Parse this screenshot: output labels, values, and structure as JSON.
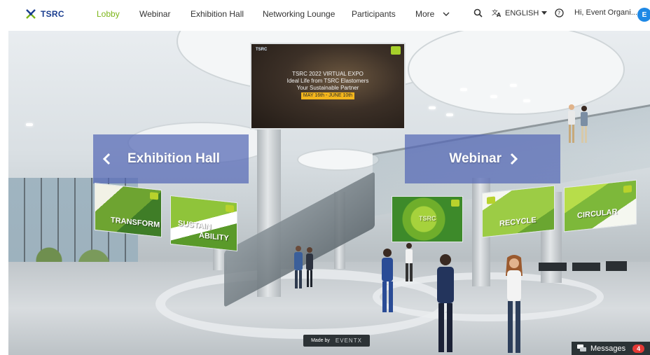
{
  "brand": {
    "name": "TSRC"
  },
  "nav": {
    "items": [
      {
        "label": "Lobby",
        "active": true
      },
      {
        "label": "Webinar",
        "active": false
      },
      {
        "label": "Exhibition Hall",
        "active": false
      },
      {
        "label": "Networking Lounge",
        "active": false
      },
      {
        "label": "Participants",
        "active": false
      },
      {
        "label": "More",
        "active": false
      }
    ]
  },
  "toolbar": {
    "search_icon": "search-icon",
    "language_icon": "translate-icon",
    "language": "ENGLISH",
    "help_icon": "help-icon",
    "user_greeting": "Hi, Event Organi...",
    "avatar_initial": "E"
  },
  "lobby": {
    "main_banner": {
      "logo": "TSRC",
      "lines": [
        "TSRC 2022 VIRTUAL EXPO",
        "Ideal Life from TSRC Elastomers",
        "Your Sustainable Partner"
      ],
      "date": "MAY 16th - JUNE 10th"
    },
    "left_panel_label": "Exhibition Hall",
    "right_panel_label": "Webinar",
    "billboards": {
      "transform": "TRANSFORM",
      "sustainability_1": "SUSTAIN",
      "sustainability_2": "ABILITY",
      "recycle": "RECYCLE",
      "circular": "CIRCULAR",
      "center_mark": "TSRC"
    }
  },
  "footer": {
    "made_by_label": "Made by",
    "made_by_brand": "EVENTX",
    "messages_label": "Messages",
    "messages_count": "4"
  },
  "colors": {
    "accent_green": "#7cb518",
    "panel_blue": "#5568b6",
    "avatar_blue": "#1e88e5",
    "badge_red": "#e53935"
  }
}
